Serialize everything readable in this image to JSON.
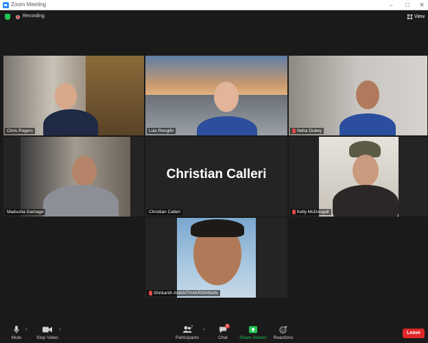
{
  "window": {
    "title": "Zoom Meeting",
    "minimize": "–",
    "maximize": "□",
    "close": "✕"
  },
  "topbar": {
    "recording_label": "Recording",
    "view_label": "View"
  },
  "participants": [
    {
      "name": "Chris Rogers",
      "muted": false
    },
    {
      "name": "Luis Rengifo",
      "muted": false,
      "active_speaker": true
    },
    {
      "name": "Neha Dubey",
      "muted": true
    },
    {
      "name": "Madusha Gamage",
      "muted": false
    },
    {
      "name": "Christian Calleri",
      "muted": false,
      "video_off": true,
      "display_name": "Christian Calleri"
    },
    {
      "name": "Kelly McDougall",
      "muted": true
    },
    {
      "name": "Shrikanth ANANTHAKRISHNAN",
      "muted": true
    }
  ],
  "toolbar": {
    "mute": "Mute",
    "stop_video": "Stop Video",
    "participants": "Participants",
    "participants_count": "7",
    "chat": "Chat",
    "chat_badge": "1",
    "share_screen": "Share Screen",
    "reactions": "Reactions",
    "leave": "Leave"
  },
  "colors": {
    "active_border": "#d9e36a",
    "share_green": "#23c552",
    "leave_red": "#e02828",
    "muted_red": "#e04a4a"
  }
}
